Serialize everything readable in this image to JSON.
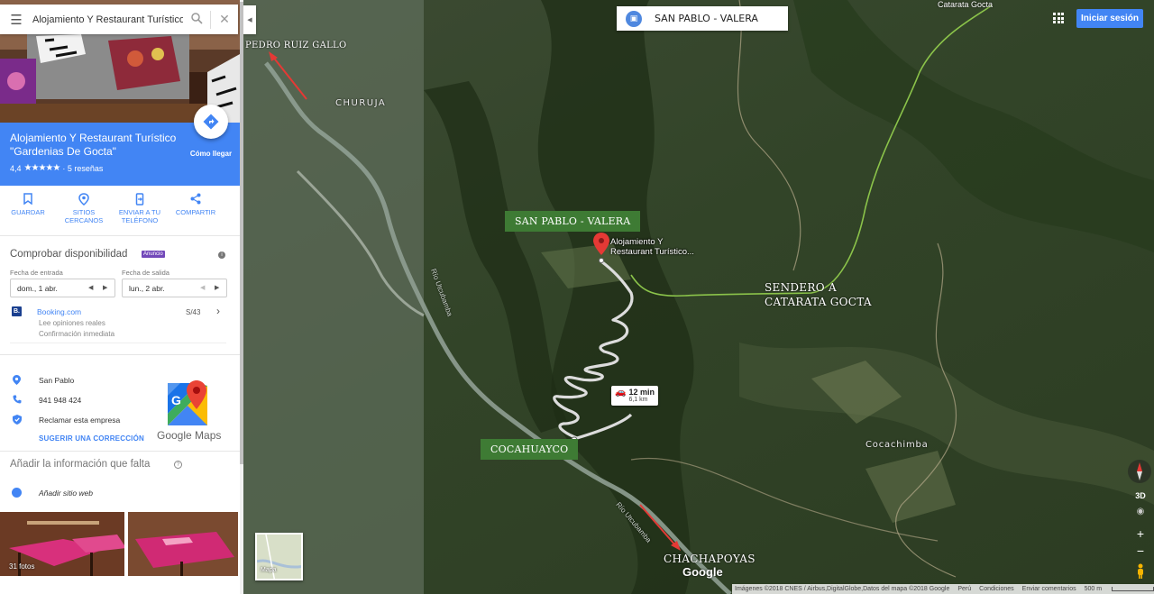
{
  "search": {
    "query": "Alojamiento Y Restaurant Turístico \"Gardenias De Gocta\""
  },
  "place": {
    "name": "Alojamiento Y Restaurant Turístico \"Gardenias De Gocta\"",
    "rating": "4,4",
    "stars": "★★★★★",
    "reviews": "· 5 reseñas",
    "directions_label": "Cómo llegar"
  },
  "actions": [
    {
      "label": "GUARDAR",
      "icon": "bookmark-icon"
    },
    {
      "label": "SITIOS CERCANOS",
      "icon": "nearby-icon"
    },
    {
      "label": "ENVIAR A TU TELÉFONO",
      "icon": "send-to-phone-icon"
    },
    {
      "label": "COMPARTIR",
      "icon": "share-icon"
    }
  ],
  "availability": {
    "title": "Comprobar disponibilidad",
    "ad_badge": "Anuncio",
    "checkin_label": "Fecha de entrada",
    "checkin_value": "dom., 1 abr.",
    "checkout_label": "Fecha de salida",
    "checkout_value": "lun., 2 abr.",
    "provider": {
      "badge": "B.",
      "name": "Booking.com",
      "line1": "Lee opiniones reales",
      "line2": "Confirmación inmediata",
      "price": "S/43"
    }
  },
  "info": {
    "address": "San Pablo",
    "phone": "941 948 424",
    "claim": "Reclamar esta empresa",
    "suggest": "SUGERIR UNA CORRECCIÓN",
    "logo_text": "Google Maps"
  },
  "missing": {
    "title": "Añadir la información que falta",
    "add_website": "Añadir sitio web"
  },
  "photos": {
    "count_label": "31 fotos"
  },
  "map": {
    "route_title": "SAN PABLO - VALERA",
    "signin": "Iniciar sesión",
    "labels": {
      "pedro_ruiz": "PEDRO RUIZ GALLO",
      "churuja": "CHURUJA",
      "san_pablo_valera": "SAN PABLO - VALERA",
      "sendero_1": "SENDERO A",
      "sendero_2": "CATARATA GOCTA",
      "cocahuayco": "COCAHUAYCO",
      "chachapoyas": "CHACHAPOYAS",
      "cocachimba": "Cocachimba",
      "catarata": "Catarata Gocta",
      "river": "Río Utcubamba",
      "river2": "Río Utcubamba"
    },
    "marker_label_1": "Alojamiento Y",
    "marker_label_2": "Restaurant Turístico...",
    "travel_time": "12 min",
    "travel_distance": "6,1 km",
    "google": "Google",
    "minimap_label": "Mapa",
    "btn_3d": "3D",
    "footer": {
      "imagery": "Imágenes ©2018 CNES / Airbus,DigitalGlobe,Datos del mapa ©2018 Google",
      "country": "Perú",
      "terms": "Condiciones",
      "feedback": "Enviar comentarios",
      "scale": "500 m"
    },
    "colors": {
      "trail": "#8bc34a",
      "route": "#d9d9d9",
      "arrow": "#e53935",
      "label_green": "#3e7b34",
      "brand": "#4285f4"
    }
  }
}
